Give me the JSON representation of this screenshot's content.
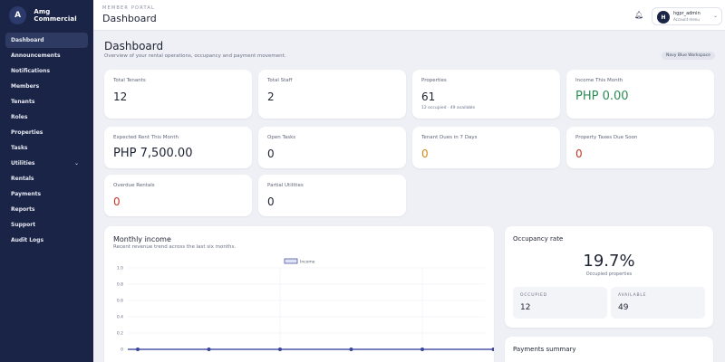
{
  "brand": {
    "initial": "A",
    "name": "Amg Commercial"
  },
  "sidebar": {
    "items": [
      {
        "label": "Dashboard",
        "active": true
      },
      {
        "label": "Announcements"
      },
      {
        "label": "Notifications"
      },
      {
        "label": "Members"
      },
      {
        "label": "Tenants"
      },
      {
        "label": "Roles"
      },
      {
        "label": "Properties"
      },
      {
        "label": "Tasks"
      },
      {
        "label": "Utilities",
        "expandable": true
      },
      {
        "label": "Rentals"
      },
      {
        "label": "Payments"
      },
      {
        "label": "Reports"
      },
      {
        "label": "Support"
      },
      {
        "label": "Audit Logs"
      }
    ]
  },
  "topbar": {
    "portal_label": "MEMBER PORTAL",
    "title": "Dashboard",
    "user": {
      "initial": "H",
      "name": "hgpr_admin",
      "role": "Account menu"
    }
  },
  "header": {
    "title": "Dashboard",
    "subtitle": "Overview of your rental operations, occupancy and payment movement.",
    "workspace": "Navy Blue Workspace"
  },
  "stats": [
    {
      "label": "Total Tenants",
      "value": "12",
      "tone": "default"
    },
    {
      "label": "Total Staff",
      "value": "2",
      "tone": "default"
    },
    {
      "label": "Properties",
      "value": "61",
      "note": "12 occupied · 49 available",
      "tone": "default"
    },
    {
      "label": "Income This Month",
      "value": "PHP 0.00",
      "tone": "green"
    },
    {
      "label": "Expected Rent This Month",
      "value": "PHP 7,500.00",
      "tone": "default"
    },
    {
      "label": "Open Tasks",
      "value": "0",
      "tone": "default"
    },
    {
      "label": "Tenant Dues in 7 Days",
      "value": "0",
      "tone": "orange"
    },
    {
      "label": "Property Taxes Due Soon",
      "value": "0",
      "tone": "red"
    },
    {
      "label": "Overdue Rentals",
      "value": "0",
      "tone": "red"
    },
    {
      "label": "Partial Utilities",
      "value": "0",
      "tone": "default"
    }
  ],
  "income": {
    "title": "Monthly income",
    "subtitle": "Recent revenue trend across the last six months."
  },
  "chart_data": {
    "type": "line",
    "series": [
      {
        "name": "Income",
        "values": [
          0,
          0,
          0,
          0,
          0,
          0
        ]
      }
    ],
    "ylim": [
      0,
      1.0
    ],
    "yticks": [
      "1.0",
      "0.8",
      "0.6",
      "0.4",
      "0.2",
      "0"
    ],
    "grid": true,
    "legend": "top-center",
    "colors": {
      "line": "#4a56a6",
      "point": "#3a4696"
    }
  },
  "occupancy": {
    "title": "Occupancy rate",
    "rate": "19.7%",
    "subtitle": "Occupied properties",
    "occupied_label": "OCCUPIED",
    "occupied_value": "12",
    "available_label": "AVAILABLE",
    "available_value": "49"
  },
  "payments": {
    "title": "Payments summary"
  },
  "colors": {
    "sidebar": "#1a2447",
    "accent": "#1a2447",
    "green": "#2e8b57",
    "orange": "#d08a1a",
    "red": "#c0392b"
  }
}
